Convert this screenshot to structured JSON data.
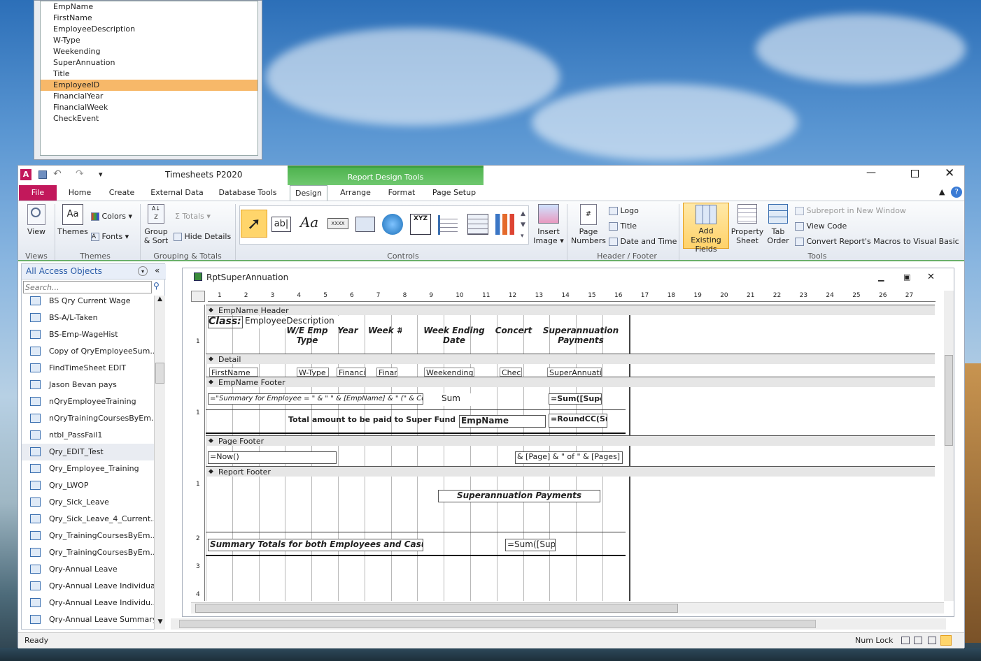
{
  "field_list": {
    "items": [
      "EmpName",
      "FirstName",
      "EmployeeDescription",
      "W-Type",
      "Weekending",
      "SuperAnnuation",
      "Title",
      "EmployeeID",
      "FinancialYear",
      "FinancialWeek",
      "CheckEvent"
    ],
    "selected_index": 7
  },
  "window": {
    "title": "Timesheets P2020",
    "contextual_tab": "Report Design Tools",
    "app_icon": "A"
  },
  "tabs": {
    "file": "File",
    "home": "Home",
    "create": "Create",
    "external": "External Data",
    "dbtools": "Database Tools",
    "design": "Design",
    "arrange": "Arrange",
    "format": "Format",
    "pagesetup": "Page Setup"
  },
  "ribbon": {
    "views": {
      "view": "View",
      "group": "Views"
    },
    "themes": {
      "themes": "Themes",
      "colors": "Colors",
      "fonts": "Fonts",
      "group": "Themes"
    },
    "grouping": {
      "group_sort_1": "Group",
      "group_sort_2": "& Sort",
      "totals": "Totals",
      "hide_details": "Hide Details",
      "group": "Grouping & Totals"
    },
    "controls": {
      "group": "Controls",
      "textbox": "ab|",
      "label": "Aa",
      "button": "XXXX",
      "xyz": "XYZ",
      "insert_image_1": "Insert",
      "insert_image_2": "Image"
    },
    "header_footer": {
      "page_numbers_1": "Page",
      "page_numbers_2": "Numbers",
      "logo": "Logo",
      "title": "Title",
      "date_time": "Date and Time",
      "group": "Header / Footer"
    },
    "tools": {
      "add_fields_1": "Add Existing",
      "add_fields_2": "Fields",
      "property_1": "Property",
      "property_2": "Sheet",
      "tab_order_1": "Tab",
      "tab_order_2": "Order",
      "subreport": "Subreport in New Window",
      "view_code": "View Code",
      "convert": "Convert Report's Macros to Visual Basic",
      "group": "Tools"
    }
  },
  "nav": {
    "header": "All Access Objects",
    "search_placeholder": "Search...",
    "items": [
      "BS Qry Current Wage",
      "BS-A/L-Taken",
      "BS-Emp-WageHist",
      "Copy of QryEmployeeSum...",
      "FindTimeSheet EDIT",
      "Jason Bevan pays",
      "nQryEmployeeTraining",
      "nQryTrainingCoursesByEm...",
      "ntbl_PassFail1",
      "Qry_EDIT_Test",
      "Qry_Employee_Training",
      "Qry_LWOP",
      "Qry_Sick_Leave",
      "Qry_Sick_Leave_4_Current...",
      "Qry_TrainingCoursesByEm...",
      "Qry_TrainingCoursesByEm...",
      "Qry-Annual Leave",
      "Qry-Annual Leave Individual",
      "Qry-Annual Leave Individu...",
      "Qry-Annual Leave Summary"
    ],
    "hover_index": 9
  },
  "report": {
    "title": "RptSuperAnnuation",
    "ruler": [
      "1",
      "2",
      "3",
      "4",
      "5",
      "6",
      "7",
      "8",
      "9",
      "10",
      "11",
      "12",
      "13",
      "14",
      "15",
      "16",
      "17",
      "18",
      "19",
      "20",
      "21",
      "22",
      "23",
      "24",
      "25",
      "26",
      "27"
    ],
    "sections": {
      "header": "EmpName Header",
      "detail": "Detail",
      "footer": "EmpName Footer",
      "page_footer": "Page Footer",
      "report_footer": "Report Footer"
    },
    "header_controls": {
      "class_label": "Class:",
      "emp_desc": "EmployeeDescription",
      "we_emp_type": "W/E Emp Type",
      "year": "Year",
      "week": "Week #",
      "week_ending": "Week Ending Date",
      "concert": "Concert",
      "super": "Superannuation Payments"
    },
    "detail_controls": {
      "firstname": "FirstName",
      "wtype": "W-Type",
      "financi": "Financi",
      "finar": "Finar",
      "weekending": "Weekending",
      "chec": "Chec",
      "superannuatio": "SuperAnnuatio"
    },
    "footer_controls": {
      "summary": "=\"Summary for Employee = \" & \" \" & [EmpName] & \" (\" & Count",
      "sum": "Sum",
      "sum_super": "=Sum([Super",
      "total_label": "Total amount to be paid to Super Fund for",
      "empname": "EmpName",
      "roundcc": "=RoundCC(Su"
    },
    "page_footer_controls": {
      "now": "=Now()",
      "pages": "& [Page] & \" of \" & [Pages]"
    },
    "report_footer_controls": {
      "super_payments": "Superannuation Payments",
      "summary_totals": "Summary Totals for both Employees and Casuals",
      "sum_sup": "=Sum([Sup"
    },
    "vruler": [
      "1",
      "1",
      "1",
      "2",
      "3",
      "4"
    ]
  },
  "status": {
    "ready": "Ready",
    "numlock": "Num Lock"
  },
  "colors": {
    "file_tab": "#c2185b",
    "contextual": "#4caf50",
    "selected_field": "#f7b869",
    "ribbon_accent": "#6ab06a"
  }
}
